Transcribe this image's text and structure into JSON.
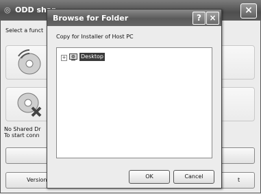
{
  "back_window": {
    "title": "ODD shar",
    "prompt": "Select a funct",
    "status_line1": "No Shared Dr",
    "status_line2": "To start conn",
    "version_button": "Version I",
    "version_button_tail": "t"
  },
  "dialog": {
    "title": "Browse for Folder",
    "help_label": "?",
    "close_label": "×",
    "description": "Copy for Installer of Host PC",
    "tree": {
      "expander": "+",
      "root_label": "Desktop"
    },
    "ok_label": "OK",
    "cancel_label": "Cancel"
  },
  "icons": {
    "app_icon": "app-disc-icon",
    "desktop_icon": "desktop-icon",
    "disc_share": "disc-share-icon",
    "disc_disconnect": "disc-disconnect-icon"
  }
}
